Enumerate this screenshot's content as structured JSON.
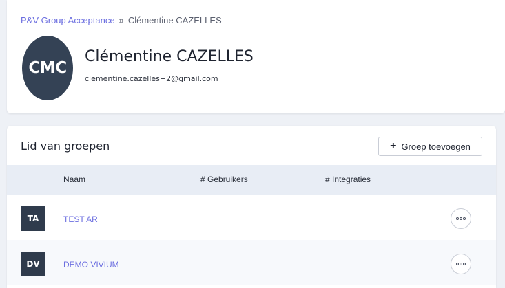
{
  "breadcrumb": {
    "parent": "P&V Group Acceptance",
    "separator": "»",
    "current": "Clémentine CAZELLES"
  },
  "user": {
    "initials": "CMC",
    "name": "Clémentine CAZELLES",
    "email": "clementine.cazelles+2@gmail.com"
  },
  "groups": {
    "title": "Lid van groepen",
    "add_button": {
      "icon": "plus-icon",
      "label": "Groep toevoegen"
    },
    "columns": [
      "Naam",
      "# Gebruikers",
      "# Integraties"
    ],
    "rows": [
      {
        "badge": "TA",
        "name": "TEST AR",
        "users": "",
        "integrations": "",
        "action_icon": "more-options-icon"
      },
      {
        "badge": "DV",
        "name": "DEMO VIVIUM",
        "users": "",
        "integrations": "",
        "action_icon": "more-options-icon"
      }
    ]
  },
  "colors": {
    "link": "#6c6fe0",
    "avatar_bg": "#344255",
    "badge_bg": "#2f3b4c",
    "table_header_bg": "#e8edf5",
    "page_bg": "#eef1f6"
  }
}
